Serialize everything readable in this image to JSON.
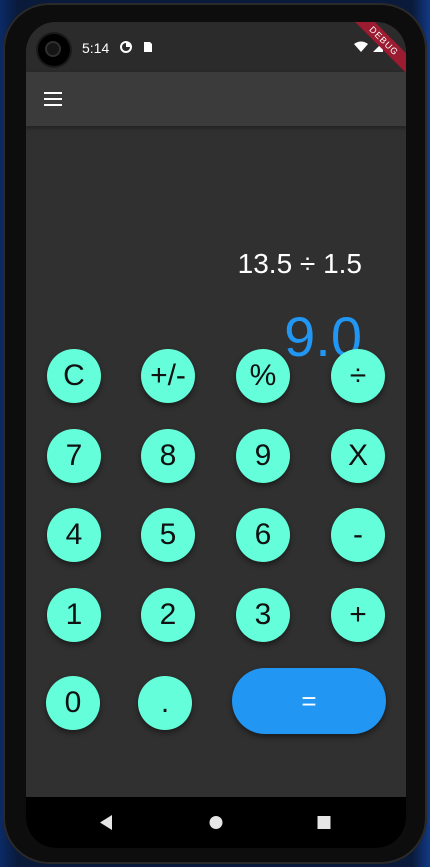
{
  "status": {
    "time": "5:14",
    "banner": "DEBUG"
  },
  "appbar": {
    "menu_icon": "menu-icon"
  },
  "display": {
    "expression": "13.5 ÷ 1.5",
    "result": "9.0"
  },
  "keypad": {
    "row1": [
      "C",
      "+/-",
      "%",
      "÷"
    ],
    "row2": [
      "7",
      "8",
      "9",
      "X"
    ],
    "row3": [
      "4",
      "5",
      "6",
      "-"
    ],
    "row4": [
      "1",
      "2",
      "3",
      "+"
    ],
    "row5": [
      "0",
      ".",
      "="
    ]
  },
  "colors": {
    "key_bg": "#64ffda",
    "accent": "#2196f3",
    "screen_bg": "#303030",
    "appbar_bg": "#3b3b3b"
  },
  "nav": {
    "icons": [
      "back-icon",
      "home-icon",
      "recents-icon"
    ]
  }
}
